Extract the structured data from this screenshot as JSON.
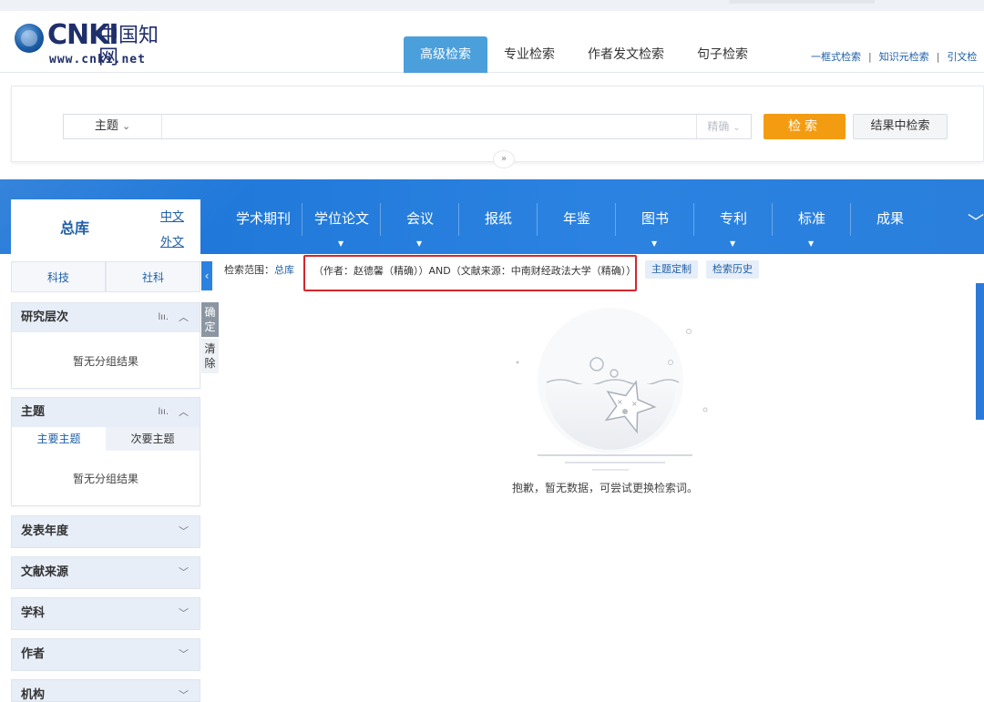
{
  "header": {
    "logo_brand": "CNKI",
    "logo_cn": "中国知网",
    "logo_url": "www.cnki.net",
    "tabs": [
      {
        "label": "高级检索",
        "active": true
      },
      {
        "label": "专业检索",
        "active": false
      },
      {
        "label": "作者发文检索",
        "active": false
      },
      {
        "label": "句子检索",
        "active": false
      }
    ],
    "links": [
      "一框式检索",
      "知识元检索",
      "引文检"
    ]
  },
  "search": {
    "field": "主题",
    "field_caret": "⌄",
    "input_value": "",
    "precision": "精确",
    "search_label": "检索",
    "in_result_label": "结果中检索",
    "expand_icon": "chevron-double-down-icon"
  },
  "db_bar": {
    "total_label": "总库",
    "lang_cn": "中文",
    "lang_en": "外文",
    "tabs": [
      {
        "label": "学术期刊",
        "has_caret": false
      },
      {
        "label": "学位论文",
        "has_caret": true
      },
      {
        "label": "会议",
        "has_caret": true
      },
      {
        "label": "报纸",
        "has_caret": false
      },
      {
        "label": "年鉴",
        "has_caret": false
      },
      {
        "label": "图书",
        "has_caret": true
      },
      {
        "label": "专利",
        "has_caret": true
      },
      {
        "label": "标准",
        "has_caret": true
      },
      {
        "label": "成果",
        "has_caret": false
      }
    ]
  },
  "sidebar": {
    "subject_tabs": [
      "科技",
      "社科"
    ],
    "research_level": {
      "title": "研究层次",
      "empty": "暂无分组结果"
    },
    "topic": {
      "title": "主题",
      "sub_tabs": [
        "主要主题",
        "次要主题"
      ],
      "empty": "暂无分组结果"
    },
    "filters": [
      "发表年度",
      "文献来源",
      "学科",
      "作者",
      "机构"
    ],
    "confirm_label": "确定",
    "clear_label": "清除"
  },
  "results": {
    "scope_label": "检索范围：",
    "scope_value": "总库",
    "query": "（作者：赵德馨（精确））AND（文献来源：中南财经政法大学（精确））",
    "pill_custom": "主题定制",
    "pill_history": "检索历史",
    "empty_message": "抱歉，暂无数据，可尝试更换检索词。"
  },
  "colors": {
    "accent_blue": "#2b82e0",
    "search_orange": "#f39c12",
    "highlight_red": "#d6262b"
  }
}
